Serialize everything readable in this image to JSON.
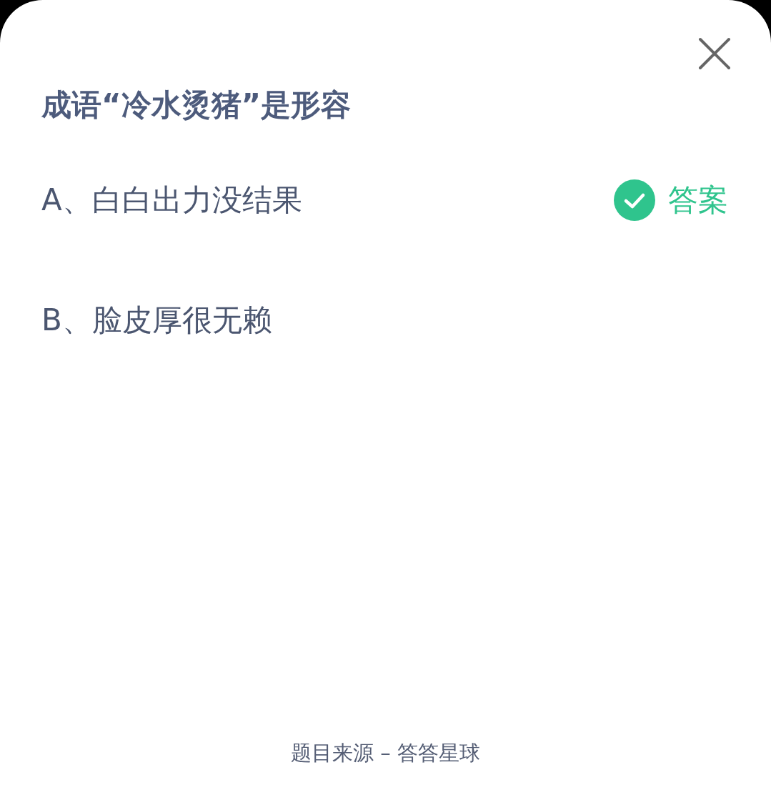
{
  "question": "成语“冷水烫猪”是形容",
  "options": [
    {
      "text": "A、白白出力没结果",
      "answer": true
    },
    {
      "text": "B、脸皮厚很无赖",
      "answer": false
    }
  ],
  "answer_label": "答案",
  "source": "题目来源 – 答答星球"
}
